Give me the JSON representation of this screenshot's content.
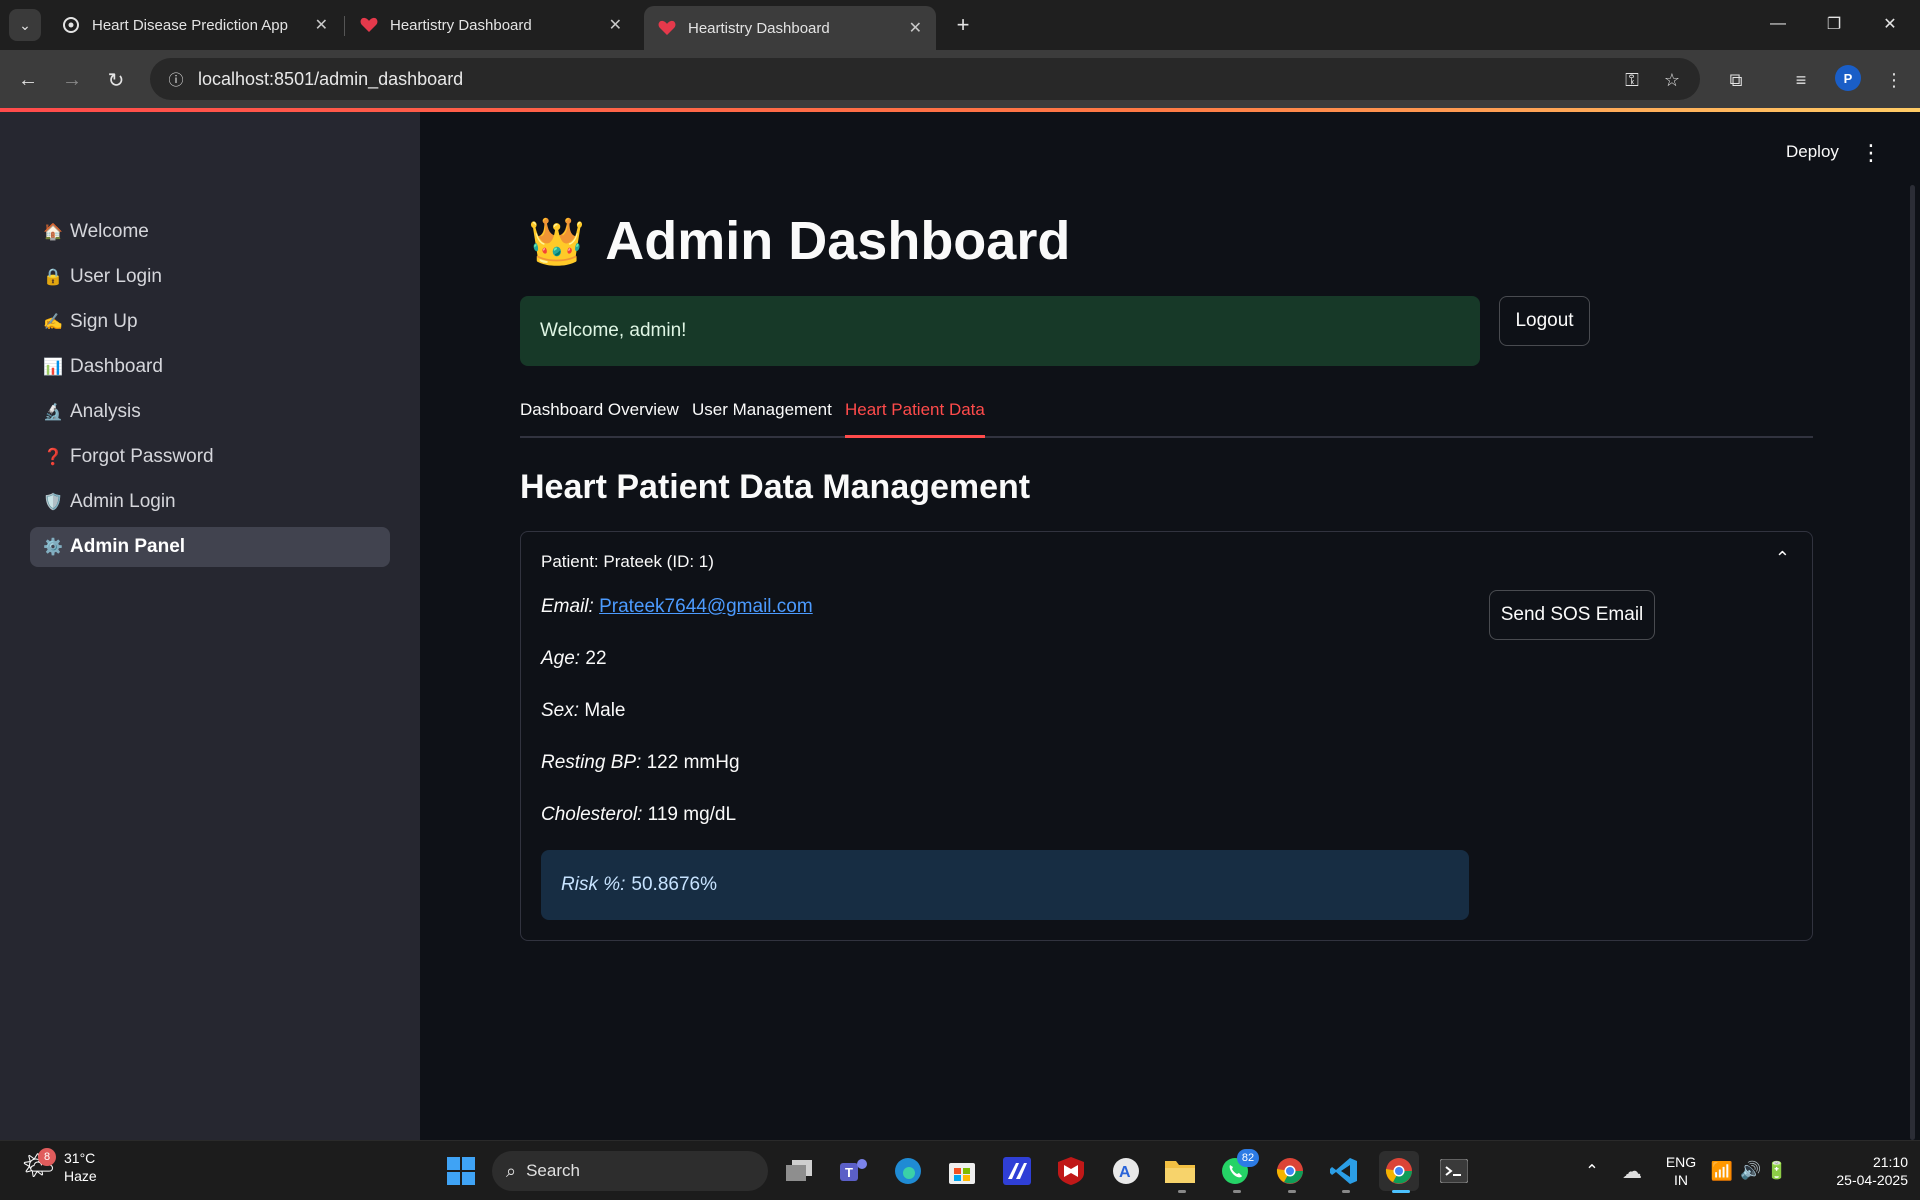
{
  "browser": {
    "tabs": [
      {
        "title": "Heart Disease Prediction App"
      },
      {
        "title": "Heartistry Dashboard"
      },
      {
        "title": "Heartistry Dashboard"
      }
    ],
    "url": "localhost:8501/admin_dashboard",
    "profile_initial": "P"
  },
  "app": {
    "deploy_label": "Deploy",
    "sidebar": {
      "items": [
        {
          "icon": "🏠",
          "label": "Welcome"
        },
        {
          "icon": "🔒",
          "label": "User Login"
        },
        {
          "icon": "✍️",
          "label": "Sign Up"
        },
        {
          "icon": "📊",
          "label": "Dashboard"
        },
        {
          "icon": "🔬",
          "label": "Analysis"
        },
        {
          "icon": "❓",
          "label": "Forgot Password"
        },
        {
          "icon": "🛡️",
          "label": "Admin Login"
        },
        {
          "icon": "⚙️",
          "label": "Admin Panel"
        }
      ],
      "active_index": 7
    },
    "page_title_icon": "👑",
    "page_title": "Admin Dashboard",
    "welcome_message": "Welcome, admin!",
    "logout_label": "Logout",
    "tabs": [
      {
        "label": "Dashboard Overview"
      },
      {
        "label": "User Management"
      },
      {
        "label": "Heart Patient Data"
      }
    ],
    "active_tab_index": 2,
    "section_title": "Heart Patient Data Management",
    "patient": {
      "header": "Patient: Prateek (ID: 1)",
      "email_label": "Email:",
      "email": "Prateek7644@gmail.com",
      "age_label": "Age:",
      "age": "22",
      "sex_label": "Sex:",
      "sex": "Male",
      "bp_label": "Resting BP:",
      "bp": "122 mmHg",
      "chol_label": "Cholesterol:",
      "chol": "119 mg/dL",
      "risk_label": "Risk %:",
      "risk": "50.8676%",
      "sos_label": "Send SOS Email"
    }
  },
  "taskbar": {
    "weather_temp": "31°C",
    "weather_desc": "Haze",
    "weather_badge": "8",
    "search_label": "Search",
    "whatsapp_badge": "82",
    "lang_top": "ENG",
    "lang_bottom": "IN",
    "time": "21:10",
    "date": "25-04-2025"
  },
  "colors": {
    "accent": "#ff4b4b",
    "success_bg": "#173928",
    "info_bg": "#172d43",
    "sidebar_bg": "#262730",
    "main_bg": "#0e1117"
  }
}
